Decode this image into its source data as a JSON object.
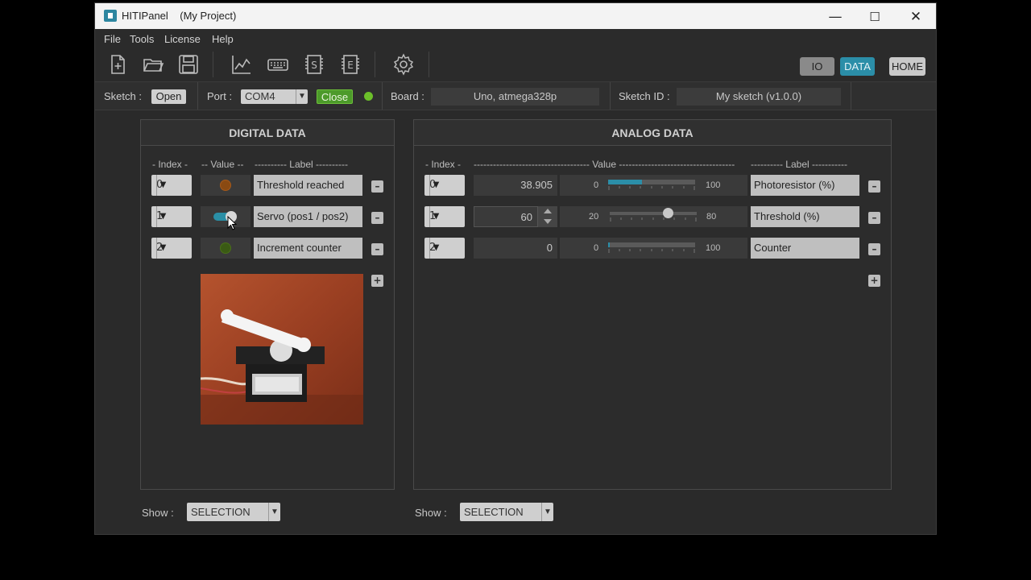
{
  "window": {
    "app_name": "HITIPanel",
    "project": "(My Project)",
    "minimize": "—",
    "maximize": "☐",
    "close": "✕"
  },
  "menu": [
    "File",
    "Tools",
    "License",
    "Help"
  ],
  "toolbar": {
    "icons": [
      "new-file-icon",
      "open-folder-icon",
      "save-icon",
      "chart-icon",
      "keyboard-icon",
      "sketch-s-icon",
      "sketch-e-icon",
      "settings-gear-icon"
    ],
    "modes": {
      "io": "IO",
      "data": "DATA",
      "home": "HOME",
      "active": "DATA"
    }
  },
  "status": {
    "sketch_label": "Sketch :",
    "open_btn": "Open",
    "port_label": "Port :",
    "port_value": "COM4",
    "close_btn": "Close",
    "board_label": "Board :",
    "board_value": "Uno, atmega328p",
    "sketch_id_label": "Sketch ID :",
    "sketch_id_value": "My sketch  (v1.0.0)"
  },
  "digital": {
    "title": "DIGITAL  DATA",
    "col_index": "- Index -",
    "col_value": "-- Value --",
    "col_label": "---------- Label ----------",
    "rows": [
      {
        "index": "0",
        "label": "Threshold reached",
        "kind": "led",
        "color": "#8a4a12"
      },
      {
        "index": "1",
        "label": "Servo (pos1 / pos2)",
        "kind": "toggle",
        "color": "#2a8fa6"
      },
      {
        "index": "2",
        "label": "Increment counter",
        "kind": "led",
        "color": "#3a5a14"
      }
    ],
    "show_label": "Show :",
    "show_value": "SELECTION"
  },
  "analog": {
    "title": "ANALOG  DATA",
    "col_index": "- Index -",
    "col_value": "------------------------------------ Value ------------------------------------",
    "col_label": "---------- Label -----------",
    "rows": [
      {
        "index": "0",
        "value": "38.905",
        "min": "0",
        "max": "100",
        "fraction": 0.389,
        "label": "Photoresistor (%)",
        "kind": "bar"
      },
      {
        "index": "1",
        "value": "60",
        "min": "20",
        "max": "80",
        "fraction": 0.667,
        "label": "Threshold (%)",
        "kind": "slider"
      },
      {
        "index": "2",
        "value": "0",
        "min": "0",
        "max": "100",
        "fraction": 0.0,
        "label": "Counter",
        "kind": "bar"
      }
    ],
    "show_label": "Show :",
    "show_value": "SELECTION"
  },
  "buttons": {
    "minus": "–",
    "plus": "+",
    "dropdown_arrow": "▼"
  }
}
